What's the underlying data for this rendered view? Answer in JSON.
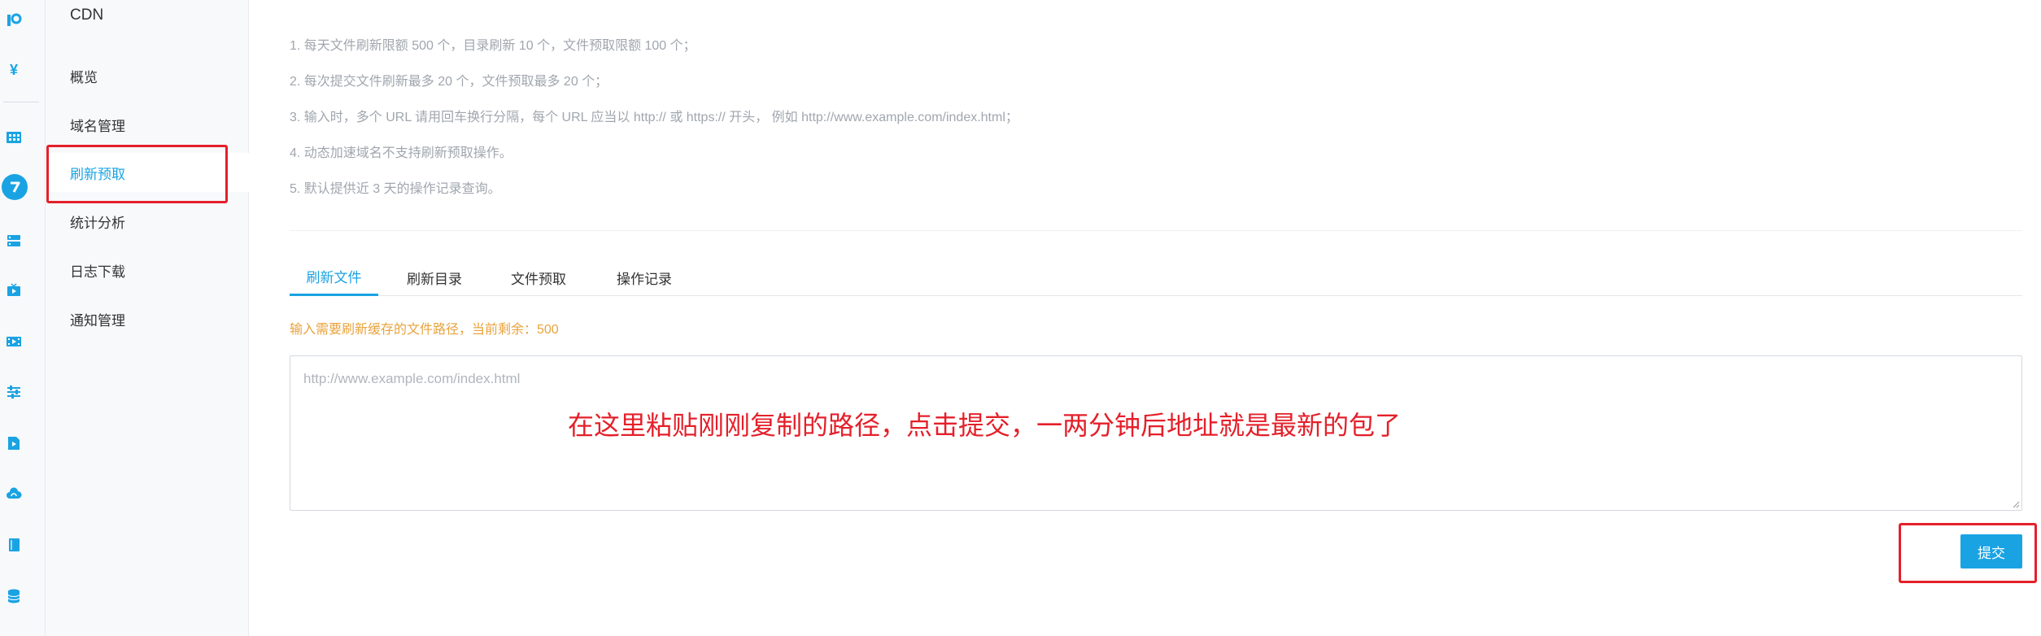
{
  "sidebar": {
    "title": "CDN",
    "items": [
      {
        "label": "概览"
      },
      {
        "label": "域名管理"
      },
      {
        "label": "刷新预取",
        "active": true
      },
      {
        "label": "统计分析"
      },
      {
        "label": "日志下载"
      },
      {
        "label": "通知管理"
      }
    ]
  },
  "rail": {
    "icons": [
      "logo-icon",
      "yuan-icon",
      "grid-icon",
      "active-product-icon",
      "server-icon",
      "tv-play-icon",
      "film-icon",
      "sliders-icon",
      "video-file-icon",
      "cloud-icon",
      "book-icon",
      "database-icon"
    ]
  },
  "notes": [
    "1. 每天文件刷新限额 500 个，目录刷新 10 个，文件预取限额 100 个；",
    "2. 每次提交文件刷新最多 20 个，文件预取最多 20 个；",
    "3. 输入时，多个 URL 请用回车换行分隔，每个 URL 应当以 http:// 或 https:// 开头， 例如 http://www.example.com/index.html；",
    "4. 动态加速域名不支持刷新预取操作。",
    "5. 默认提供近 3 天的操作记录查询。"
  ],
  "tabs": [
    {
      "label": "刷新文件",
      "active": true
    },
    {
      "label": "刷新目录"
    },
    {
      "label": "文件预取"
    },
    {
      "label": "操作记录"
    }
  ],
  "hint": "输入需要刷新缓存的文件路径，当前剩余：500",
  "input": {
    "placeholder": "http://www.example.com/index.html",
    "value": ""
  },
  "annotation": "在这里粘贴刚刚复制的路径，点击提交，一两分钟后地址就是最新的包了",
  "submit_label": "提交",
  "colors": {
    "accent": "#1aa3e3",
    "highlight": "#e4202a",
    "hint": "#e8a33d"
  }
}
